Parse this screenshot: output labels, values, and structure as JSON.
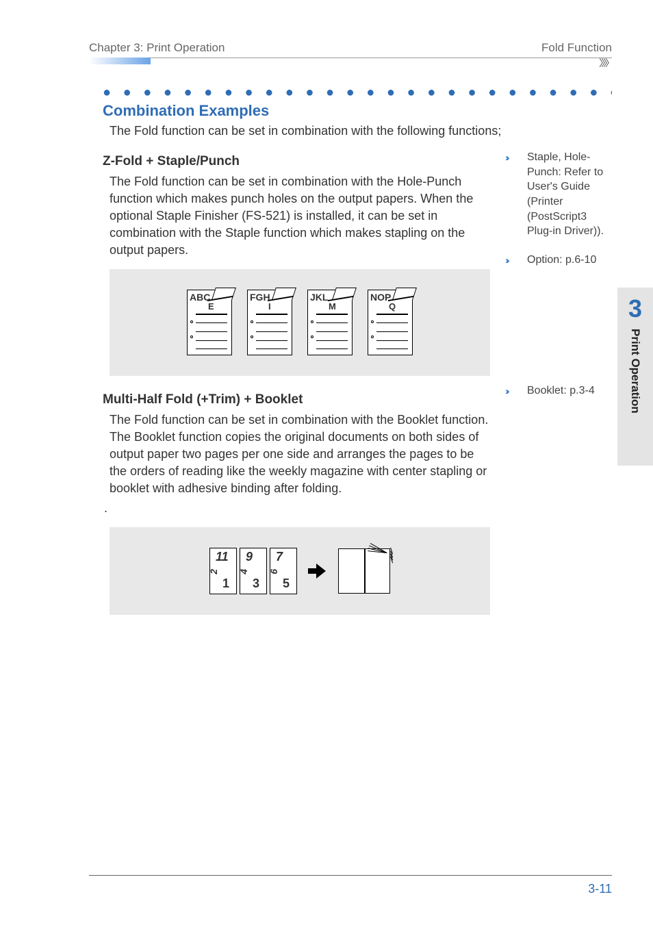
{
  "header": {
    "chapter": "Chapter 3: Print Operation",
    "section": "Fold Function"
  },
  "dots": "● ● ● ● ● ● ● ● ● ● ● ● ● ● ● ● ● ● ● ● ● ● ● ● ● ● ● ● ● ● ● ● ● ● ● ● ● ● ● ● ● ● ● ●",
  "title": "Combination Examples",
  "intro": "The Fold function can be set in combination with the following functions;",
  "sec1": {
    "heading": "Z-Fold + Staple/Punch",
    "body": "The Fold function can be set in combination with the Hole-Punch function which makes punch holes on the output papers. When the optional Staple Finisher (FS-521) is installed, it can be set in combination with the Staple function which makes stapling on the output papers.",
    "sheets": [
      {
        "top": "ABC",
        "sub": "E"
      },
      {
        "top": "FGH",
        "sub": "I"
      },
      {
        "top": "JKL",
        "sub": "M"
      },
      {
        "top": "NOP",
        "sub": "Q"
      }
    ]
  },
  "sec2": {
    "heading": "Multi-Half Fold (+Trim) + Booklet",
    "body": "The Fold function can be set in combination with the Booklet function. The Booklet function copies the original documents on both sides of output paper two pages per one side and arranges the pages to be the orders of reading like the weekly magazine with center stapling or booklet with adhesive binding after folding.",
    "trail": ".",
    "cards": [
      {
        "ghost": "2",
        "top": "11",
        "face": "1"
      },
      {
        "ghost": "4",
        "top": "9",
        "face": "3"
      },
      {
        "ghost": "6",
        "top": "7",
        "face": "5"
      }
    ]
  },
  "sidebar": {
    "note1": "Staple, Hole-Punch: Refer to User's Guide (Printer (PostScript3 Plug-in Driver)).",
    "note2": "Option: p.6-10",
    "note3": "Booklet: p.3-4"
  },
  "tab": {
    "chnum": "3",
    "chlabel": "Print Operation"
  },
  "footer": {
    "pagenum": "3-11"
  }
}
